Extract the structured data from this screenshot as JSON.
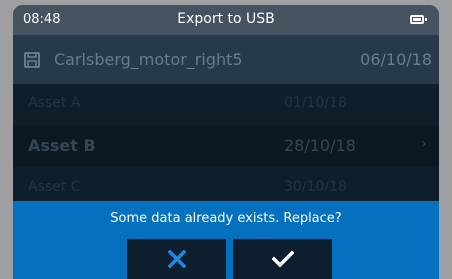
{
  "status_bar": {
    "time": "08:48",
    "title": "Export to USB",
    "battery_icon": "battery-icon"
  },
  "file": {
    "icon": "save-icon",
    "name": "Carlsberg_motor_right5",
    "date": "06/10/18"
  },
  "assets": [
    {
      "name": "Asset A",
      "date": "01/10/18"
    },
    {
      "name": "Asset B",
      "date": "28/10/18",
      "selected": true,
      "chevron": "›"
    },
    {
      "name": "Asset C",
      "date": "30/10/18"
    }
  ],
  "dialog": {
    "message": "Some data already exists. Replace?",
    "cancel_icon": "close-icon",
    "confirm_icon": "checkmark-icon"
  },
  "colors": {
    "accent": "#0470c0",
    "header": "#455361",
    "panel": "#0c1822",
    "cancel_icon": "#1e88e5",
    "confirm_icon": "#ffffff"
  }
}
